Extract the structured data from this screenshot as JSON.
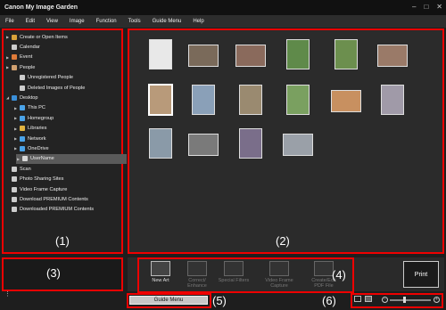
{
  "window": {
    "title": "Canon My Image Garden",
    "controls": [
      "–",
      "□",
      "✕"
    ]
  },
  "menu": [
    "File",
    "Edit",
    "View",
    "Image",
    "Function",
    "Tools",
    "Guide Menu",
    "Help"
  ],
  "sidebar": {
    "items": [
      {
        "label": "Create or Open Items",
        "icon": "create-items-icon",
        "caret": "▶",
        "color": "#d9a23a"
      },
      {
        "label": "Calendar",
        "icon": "calendar-icon",
        "caret": "",
        "color": "#cccccc"
      },
      {
        "label": "Event",
        "icon": "event-icon",
        "caret": "▶",
        "color": "#e07b39"
      },
      {
        "label": "People",
        "icon": "people-icon",
        "caret": "▶",
        "color": "#d0a070"
      },
      {
        "label": "Unregistered People",
        "icon": "unregistered-people-icon",
        "caret": "",
        "color": "#cccccc"
      },
      {
        "label": "Deleted Images of People",
        "icon": "deleted-people-icon",
        "caret": "",
        "color": "#cccccc"
      },
      {
        "label": "Desktop",
        "icon": "desktop-folder-icon",
        "caret": "◢",
        "color": "#3a8fd9"
      },
      {
        "label": "This PC",
        "icon": "this-pc-icon",
        "caret": "▶",
        "color": "#4aa3e8"
      },
      {
        "label": "Homegroup",
        "icon": "homegroup-icon",
        "caret": "▶",
        "color": "#4aa3e8"
      },
      {
        "label": "Libraries",
        "icon": "libraries-icon",
        "caret": "▶",
        "color": "#e0b340"
      },
      {
        "label": "Network",
        "icon": "network-icon",
        "caret": "▶",
        "color": "#4aa3e8"
      },
      {
        "label": "OneDrive",
        "icon": "onedrive-icon",
        "caret": "▶",
        "color": "#4aa3e8"
      },
      {
        "label": "UserName",
        "icon": "user-folder-icon",
        "caret": "▶",
        "color": "#d8d8d8",
        "selected": true
      },
      {
        "label": "Scan",
        "icon": "scan-icon",
        "caret": "",
        "color": "#cccccc"
      },
      {
        "label": "Photo Sharing Sites",
        "icon": "photo-sharing-icon",
        "caret": "",
        "color": "#cccccc"
      },
      {
        "label": "Video Frame Capture",
        "icon": "video-capture-icon",
        "caret": "",
        "color": "#cccccc"
      },
      {
        "label": "Download PREMIUM Contents",
        "icon": "download-premium-icon",
        "caret": "",
        "color": "#cccccc"
      },
      {
        "label": "Downloaded PREMIUM Contents",
        "icon": "downloaded-premium-icon",
        "caret": "",
        "color": "#cccccc"
      }
    ]
  },
  "thumbnails": [
    {
      "color": "#e8e8e8"
    },
    {
      "color": "#7a6a5a"
    },
    {
      "color": "#8a6a5c"
    },
    {
      "color": "#5f8a4a"
    },
    {
      "color": "#6c8f4e"
    },
    {
      "color": "#9a7a68"
    },
    {
      "color": "#b89a7a"
    },
    {
      "color": "#8aa0b8"
    },
    {
      "color": "#9a8a70"
    },
    {
      "color": "#7aa060"
    },
    {
      "color": "#c89060"
    },
    {
      "color": "#a09aa8"
    },
    {
      "color": "#8a9aa8"
    },
    {
      "color": "#7a7a7a"
    },
    {
      "color": "#7a6e8a"
    },
    {
      "color": "#9aa0a8"
    }
  ],
  "regions": [
    "(1)",
    "(2)",
    "(3)",
    "(4)",
    "(5)",
    "(6)"
  ],
  "toolbar": {
    "tools": [
      {
        "label": "New Art",
        "icon": "new-art-icon",
        "enabled": true
      },
      {
        "label": "Correct/ Enhance",
        "icon": "correct-enhance-icon",
        "enabled": false
      },
      {
        "label": "Special Filters",
        "icon": "special-filters-icon",
        "enabled": false
      },
      {
        "label": "Video Frame Capture",
        "icon": "video-frame-capture-icon",
        "enabled": false
      },
      {
        "label": "Create/Edit PDF File",
        "icon": "create-edit-pdf-icon",
        "enabled": false
      }
    ],
    "print_label": "Print"
  },
  "guide_menu_label": "Guide Menu",
  "zoom": {
    "minus": "−",
    "plus": "+",
    "level": 0.35
  }
}
